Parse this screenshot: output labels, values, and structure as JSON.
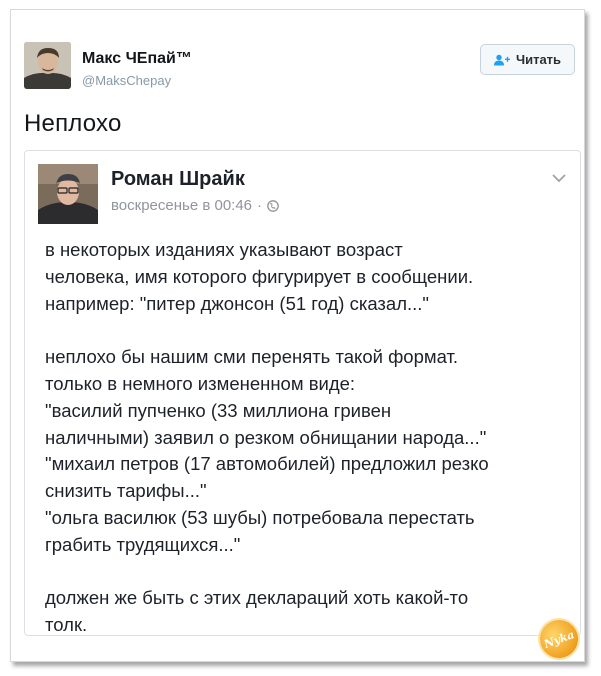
{
  "tweet": {
    "author_name": "Макс ЧЕпай™",
    "author_handle": "@MaksChepay",
    "follow_label": "Читать",
    "text": "Неплохо"
  },
  "embedded_post": {
    "author_name": "Роман Шрайк",
    "timestamp": "воскресенье в 00:46",
    "meta_separator": "·",
    "lines": [
      "в некоторых изданиях указывают возраст",
      "человека, имя которого фигурирует в сообщении.",
      "например: \"питер джонсон (51 год) сказал...\"",
      "",
      "неплохо бы нашим сми перенять такой формат.",
      "только в немного измененном виде:",
      "\"василий пупченко (33 миллиона гривен",
      "наличными) заявил о резком обнищании народа...\"",
      "\"михаил петров (17 автомобилей) предложил резко",
      "снизить тарифы...\"",
      "\"ольга василюк (53 шубы) потребовала перестать",
      "грабить трудящихся...\"",
      "",
      "должен же быть с этих деклараций хоть какой-то",
      "толк."
    ]
  },
  "watermark": {
    "text": "Nyka",
    "color": "#f0a020"
  },
  "icons": {
    "follow": "add-user-icon",
    "privacy": "globe-icon",
    "menu": "chevron-down-icon"
  }
}
